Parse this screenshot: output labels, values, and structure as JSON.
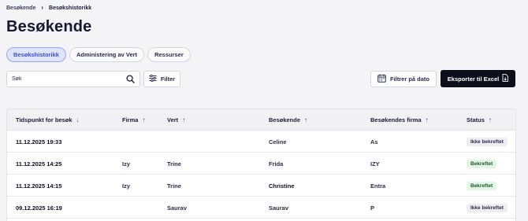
{
  "breadcrumb": {
    "parent": "Besøkende",
    "separator": "›",
    "current": "Besøkshistorikk"
  },
  "page_title": "Besøkende",
  "tabs": [
    {
      "label": "Besøkshistorikk",
      "active": true
    },
    {
      "label": "Administering av Vert",
      "active": false
    },
    {
      "label": "Ressurser",
      "active": false
    }
  ],
  "toolbar": {
    "search_placeholder": "Søk",
    "filter_label": "Filter",
    "date_filter_label": "Filtrer på dato",
    "export_label": "Eksporter til Excel"
  },
  "icons": {
    "search": "search-icon",
    "filter": "sliders-icon",
    "calendar": "calendar-icon",
    "export": "file-export-icon",
    "sort_asc": "arrow-up-icon",
    "sort_desc": "arrow-down-icon"
  },
  "colors": {
    "accent": "#4250c8",
    "primary_button": "#0d0e1c",
    "status_ok_bg": "#e3f5e6",
    "status_neutral_bg": "#eeeef1"
  },
  "table": {
    "columns": [
      {
        "label": "Tidspunkt for besøk",
        "sort": "desc"
      },
      {
        "label": "Firma",
        "sort": "asc"
      },
      {
        "label": "Vert",
        "sort": "asc"
      },
      {
        "label": "Besøkende",
        "sort": "asc"
      },
      {
        "label": "Besøkendes firma",
        "sort": "asc"
      },
      {
        "label": "Status",
        "sort": "asc"
      }
    ],
    "rows": [
      {
        "time": "11.12.2025 19:33",
        "company": "",
        "host": "",
        "visitor": "Celine",
        "visitor_company": "As",
        "status": "Ikke bekreftet",
        "status_type": "neutral"
      },
      {
        "time": "11.12.2025 14:25",
        "company": "Izy",
        "host": "Trine",
        "visitor": "Frida",
        "visitor_company": "IZY",
        "status": "Bekreftet",
        "status_type": "ok"
      },
      {
        "time": "11.12.2025 14:15",
        "company": "Izy",
        "host": "Trine",
        "visitor": "Christine",
        "visitor_company": "Entra",
        "status": "Bekreftet",
        "status_type": "ok"
      },
      {
        "time": "09.12.2025 16:19",
        "company": "",
        "host": "Saurav",
        "visitor": "Saurav",
        "visitor_company": "P",
        "status": "Ikke bekreftet",
        "status_type": "neutral"
      }
    ]
  }
}
